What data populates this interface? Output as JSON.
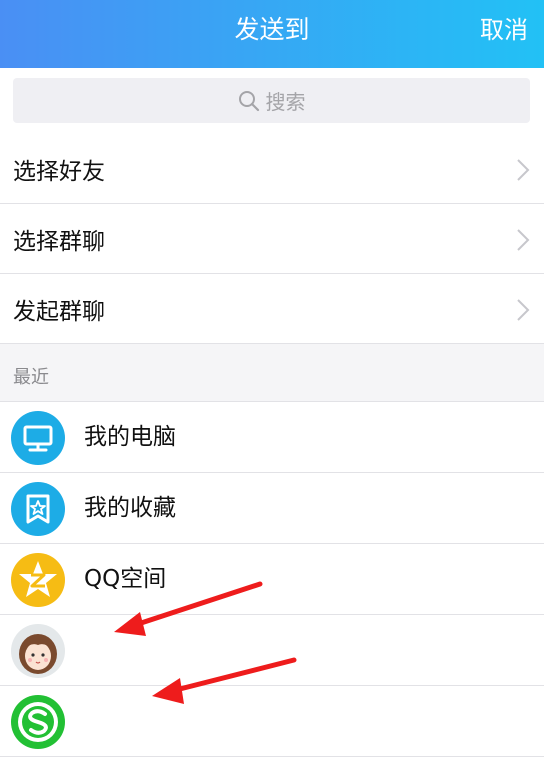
{
  "header": {
    "title": "发送到",
    "cancel_label": "取消"
  },
  "search": {
    "placeholder": "搜索"
  },
  "menu": [
    {
      "label": "选择好友"
    },
    {
      "label": "选择群聊"
    },
    {
      "label": "发起群聊"
    }
  ],
  "recent": {
    "section_label": "最近",
    "items": [
      {
        "name": "我的电脑",
        "icon": "computer-icon"
      },
      {
        "name": "我的收藏",
        "icon": "favorites-icon"
      },
      {
        "name": "QQ空间",
        "icon": "qzone-icon"
      },
      {
        "name": "",
        "icon": "user-avatar"
      },
      {
        "name": "",
        "icon": "s-app-icon"
      }
    ]
  },
  "colors": {
    "header_gradient_start": "#4a8ff4",
    "header_gradient_end": "#22c1f5",
    "blue_icon": "#1dace6",
    "yellow_icon": "#f6bc14",
    "green_icon": "#22c034",
    "annotation_arrow": "#ee1c1c"
  }
}
